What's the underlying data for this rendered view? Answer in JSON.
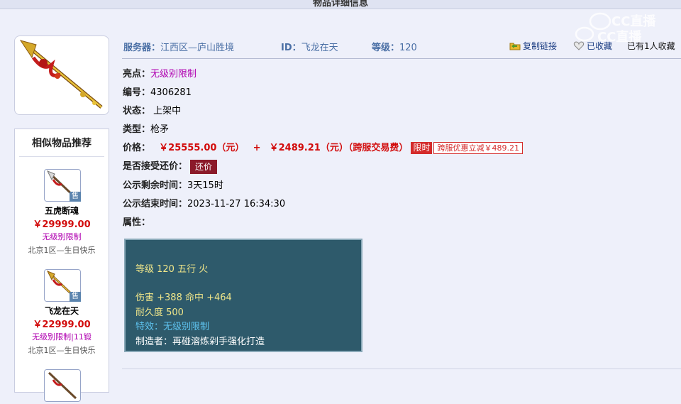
{
  "header": {
    "title": "物品详细信息"
  },
  "info_bar": {
    "server_label": "服务器：",
    "server_value": "江西区—庐山胜境",
    "id_label": "ID：",
    "id_value": "飞龙在天",
    "level_label": "等级：",
    "level_value": "120",
    "copy_link": "复制链接",
    "favorite": "已收藏",
    "favorite_count": "已有1人收藏"
  },
  "details": {
    "highlight_label": "亮点：",
    "highlight_value": "无级别限制",
    "number_label": "编号：",
    "number_value": "4306281",
    "status_label": "状态：",
    "status_value": "上架中",
    "type_label": "类型：",
    "type_value": "枪矛",
    "price_label": "价格：",
    "price_main": "￥25555.00（元）",
    "price_plus": "+",
    "price_fee": "￥2489.21（元）（跨服交易费）",
    "limited_tag": "限时",
    "discount_tag": "跨服优惠立减￥489.21",
    "counter_label": "是否接受还价：",
    "counter_button": "还价",
    "remain_label": "公示剩余时间：",
    "remain_value": "3天15时",
    "end_label": "公示结束时间：",
    "end_value": "2023-11-27 16:34:30",
    "attr_label": "属性："
  },
  "attributes": {
    "line1": "等级 120 五行 火",
    "line2": "伤害 +388 命中 +464",
    "line3": "耐久度 500",
    "line4": "特效：无级别限制",
    "line5": "制造者：再碰溶炼剁手强化打造"
  },
  "similar": {
    "title": "相似物品推荐",
    "sell_badge": "售",
    "items": [
      {
        "name": "五虎断魂",
        "price": "￥29999.00",
        "tag": "无级别限制",
        "server": "北京1区—生日快乐"
      },
      {
        "name": "飞龙在天",
        "price": "￥22999.00",
        "tag": "无级别限制|11锻",
        "server": "北京1区—生日快乐"
      }
    ]
  },
  "watermark": {
    "text": "CC直播"
  },
  "colors": {
    "price_red": "#d20b0b",
    "highlight_purple": "#b000b0",
    "link_blue": "#4a6fa5",
    "attr_bg": "#2e5a6b"
  }
}
